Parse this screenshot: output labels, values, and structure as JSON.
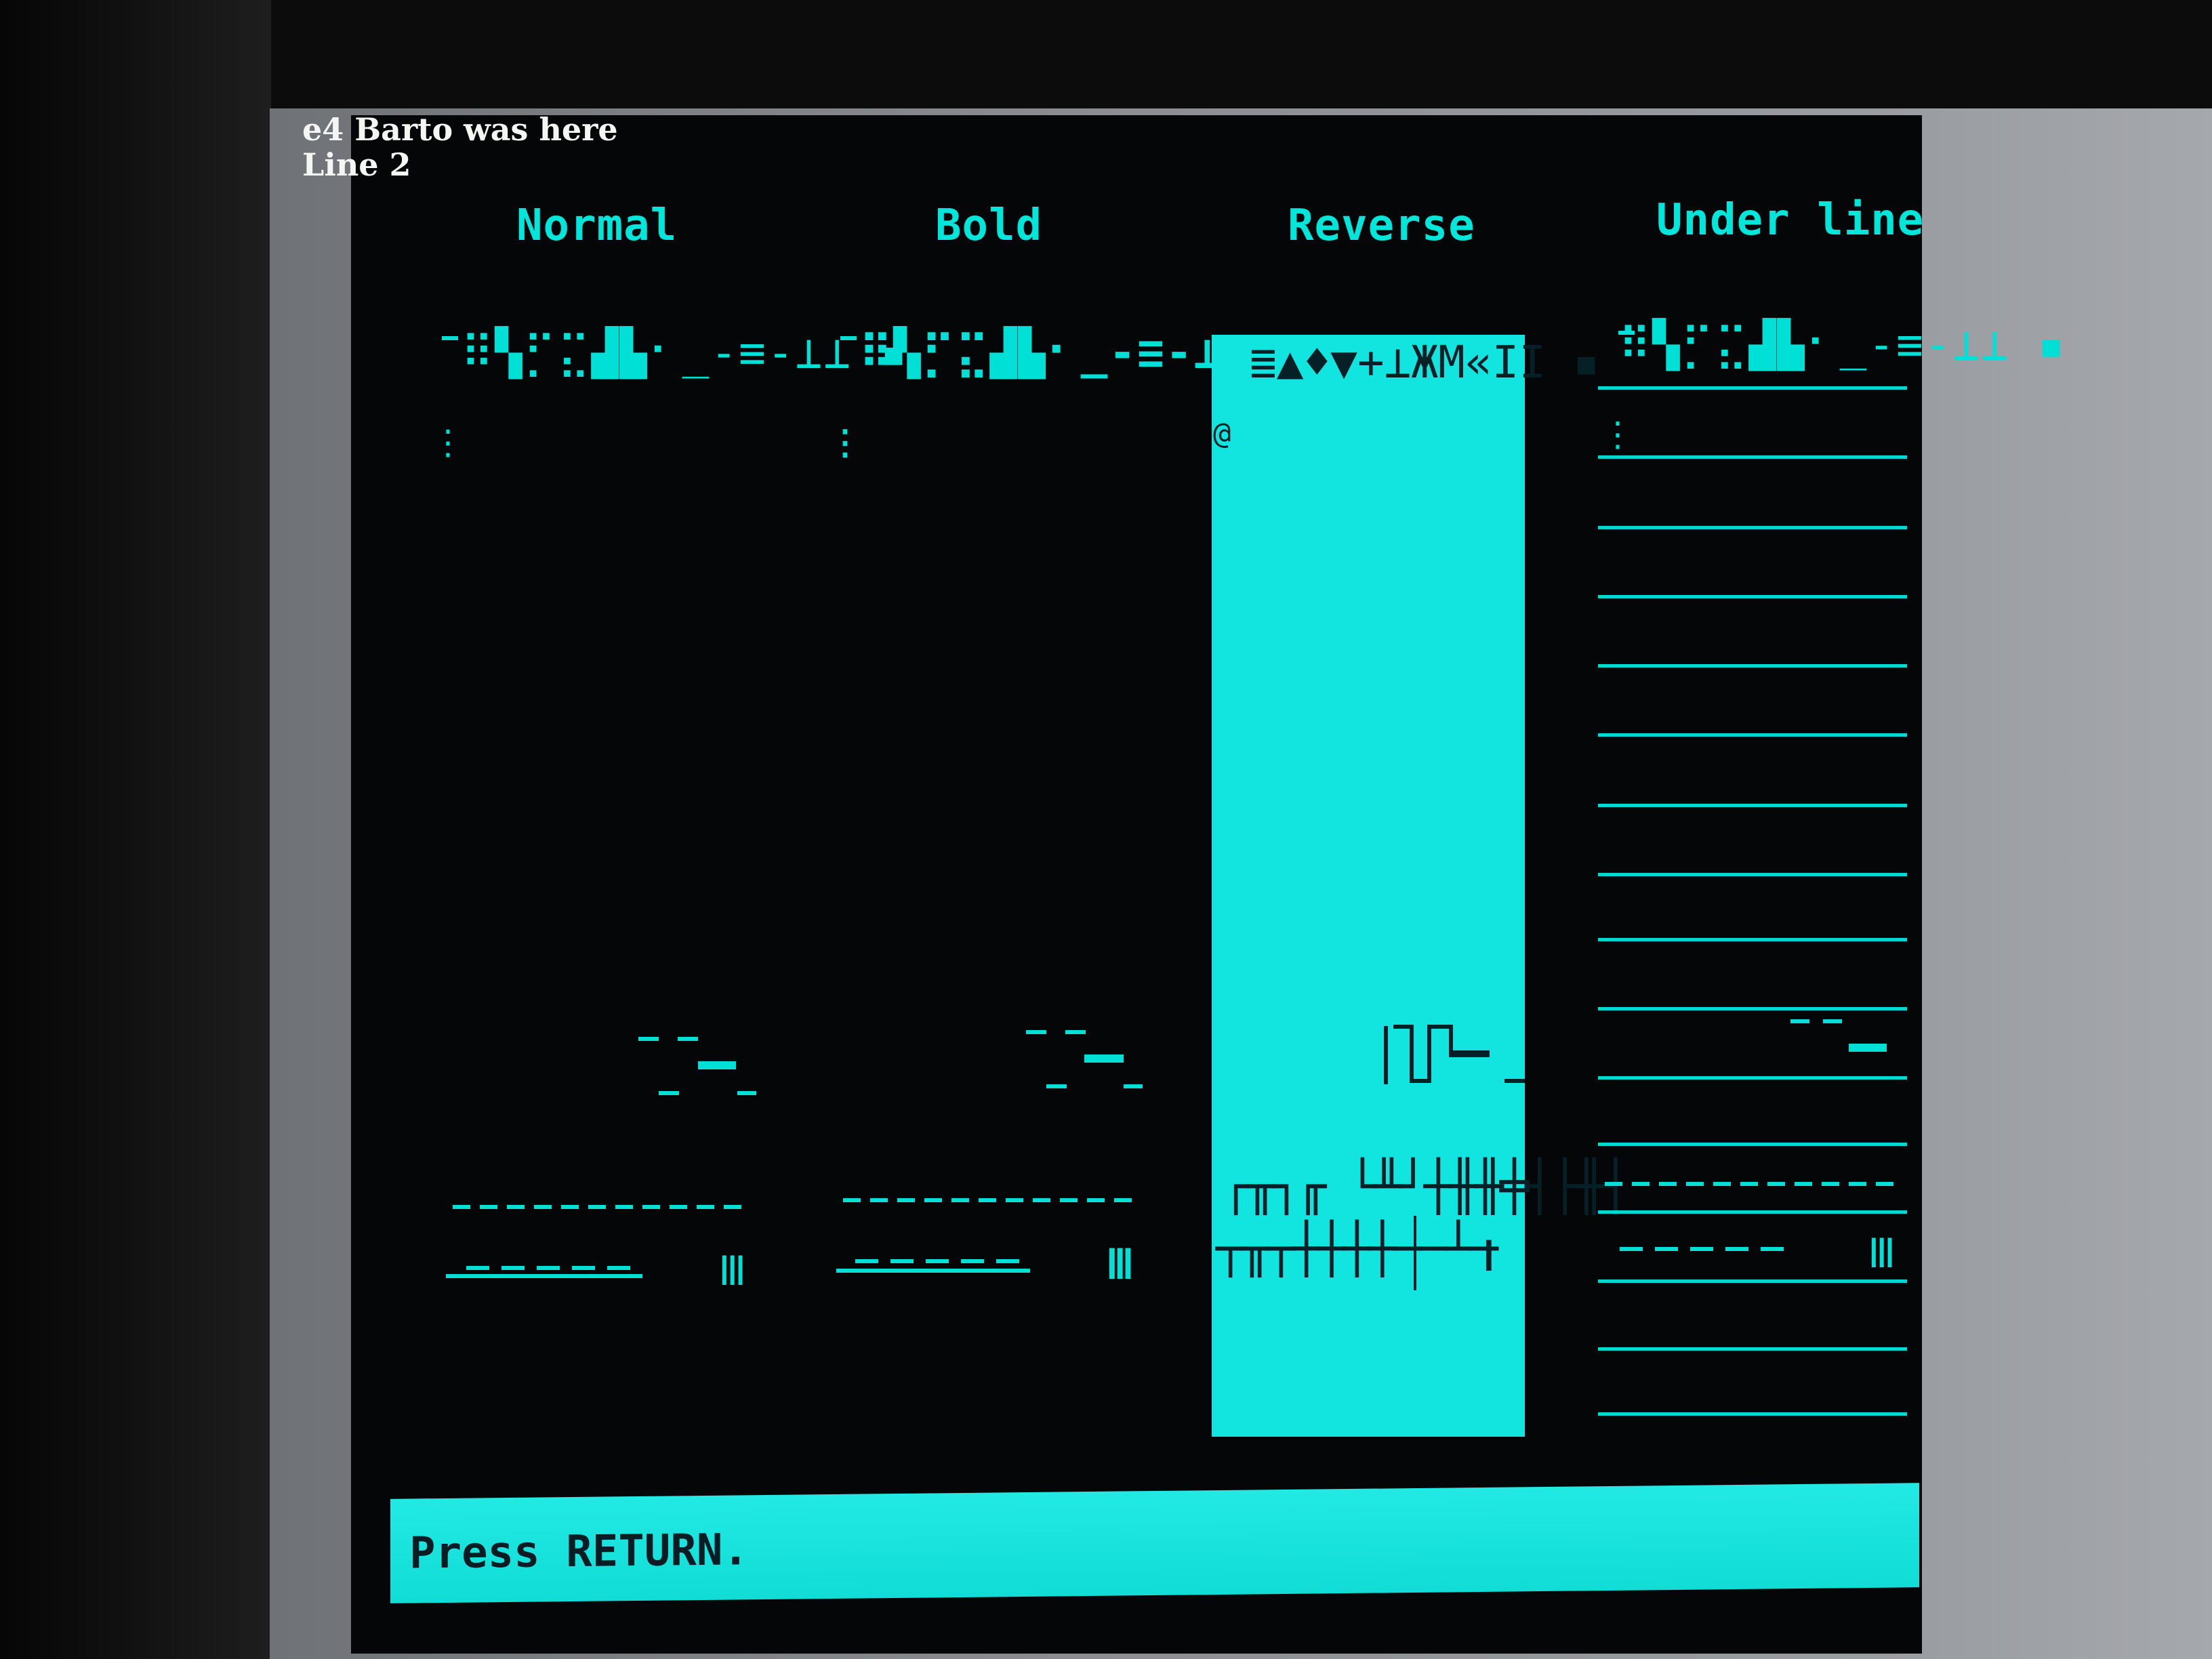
{
  "terminal": {
    "header_line_1": "e4 Barto was here",
    "header_line_2": "Line 2"
  },
  "columns": [
    {
      "title": "Normal",
      "glyphs": "⠿▚⡋⣍▟▙⠂_-≡-⊥⊥ ▪"
    },
    {
      "title": "Bold",
      "glyphs": "⠿▚⡋⣍▟▙⠂_-≡-⊥⊥ ▪"
    },
    {
      "title": "Reverse",
      "glyphs": "≣▲♦▼+⊥ЖМ«II ▪"
    },
    {
      "title": "Under line",
      "glyphs": "⠿▚⡋⣍▟▙⠂_-≡-⊥⊥ ▪"
    }
  ],
  "status_bar": {
    "text": "Press RETURN."
  },
  "colors": {
    "text_cyan": "#00e0d6",
    "reverse_bg": "#12e5df",
    "header_white": "#f4f6f4",
    "screen_bg": "#050607"
  }
}
